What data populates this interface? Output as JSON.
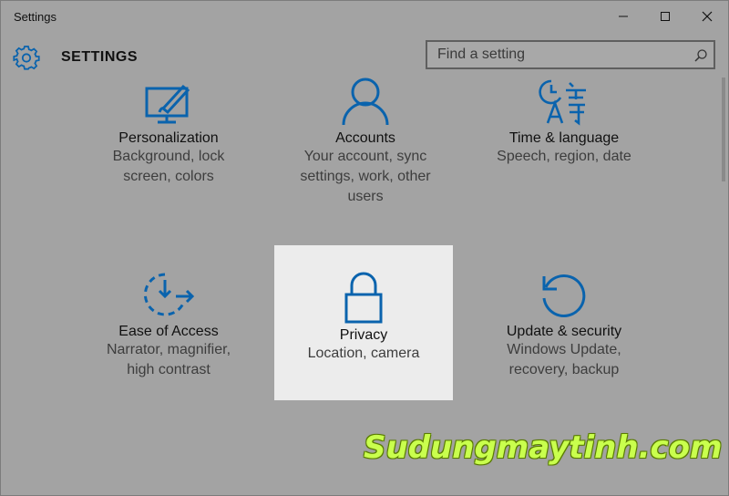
{
  "window": {
    "title": "Settings"
  },
  "header": {
    "title": "SETTINGS",
    "search_placeholder": "Find a setting"
  },
  "tiles": [
    {
      "name": "Personalization",
      "desc": [
        "Background, lock",
        "screen, colors"
      ],
      "icon": "personalization-icon"
    },
    {
      "name": "Accounts",
      "desc": [
        "Your account, sync",
        "settings, work, other",
        "users"
      ],
      "icon": "accounts-icon"
    },
    {
      "name": "Time & language",
      "desc": [
        "Speech, region, date"
      ],
      "icon": "time-language-icon"
    },
    {
      "name": "Ease of Access",
      "desc": [
        "Narrator, magnifier,",
        "high contrast"
      ],
      "icon": "ease-of-access-icon"
    },
    {
      "name": "Privacy",
      "desc": [
        "Location, camera"
      ],
      "icon": "lock-icon"
    },
    {
      "name": "Update & security",
      "desc": [
        "Windows Update,",
        "recovery, backup"
      ],
      "icon": "update-icon"
    }
  ],
  "watermark": "Sudungmaytinh.com",
  "colors": {
    "accent": "#0a63ad",
    "background": "#a3a3a3",
    "selected_tile": "#ececec",
    "watermark": "#c9ff4d"
  }
}
